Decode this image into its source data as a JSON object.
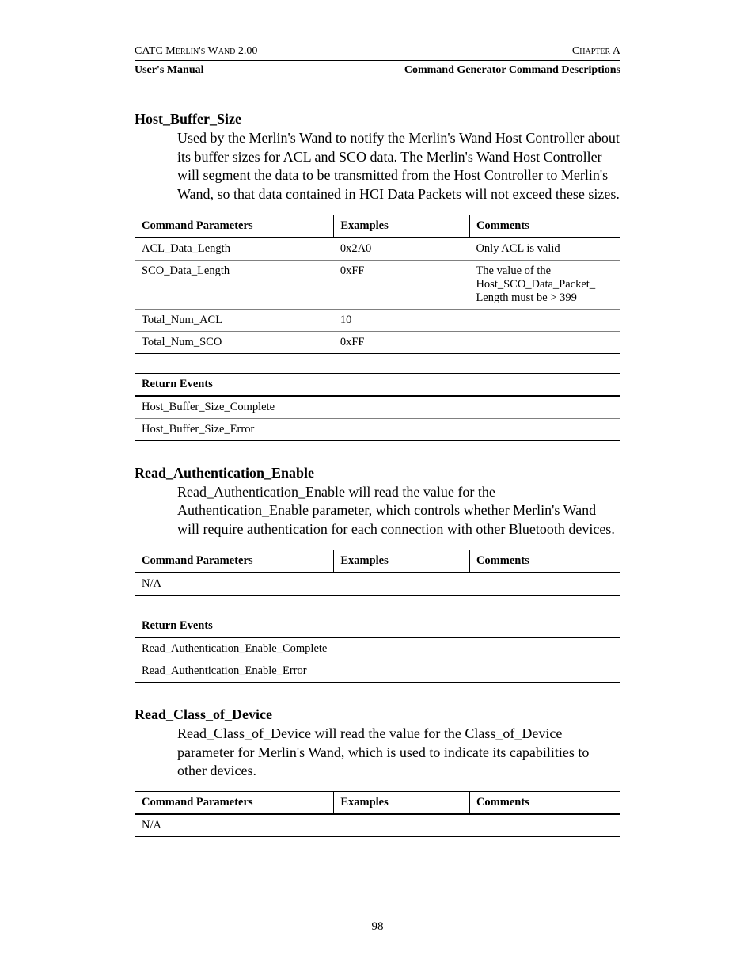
{
  "header": {
    "left_top": "CATC Merlin's Wand 2.00",
    "right_top": "Chapter A",
    "left_bot": "User's Manual",
    "right_bot": "Command Generator Command Descriptions"
  },
  "sections": [
    {
      "title": "Host_Buffer_Size",
      "body": "Used by the Merlin's Wand to notify the Merlin's Wand Host Controller about its buffer sizes for ACL and SCO data. The Merlin's Wand Host Controller will segment the data to be transmitted from the Host Controller to Merlin's Wand, so that data contained in HCI Data Packets will not exceed these sizes.",
      "param_headers": [
        "Command Parameters",
        "Examples",
        "Comments"
      ],
      "params": [
        {
          "p": "ACL_Data_Length",
          "e": "0x2A0",
          "c": "Only ACL is valid"
        },
        {
          "p": "SCO_Data_Length",
          "e": "0xFF",
          "c": "The value of the Host_SCO_Data_Packet_ Length must be > 399"
        },
        {
          "p": "Total_Num_ACL",
          "e": "10",
          "c": ""
        },
        {
          "p": "Total_Num_SCO",
          "e": "0xFF",
          "c": ""
        }
      ],
      "return_header": "Return Events",
      "returns": [
        "Host_Buffer_Size_Complete",
        "Host_Buffer_Size_Error"
      ]
    },
    {
      "title": "Read_Authentication_Enable",
      "body": "Read_Authentication_Enable will read the value for the Authentication_Enable parameter, which controls whether Merlin's Wand will require authentication for each connection with other Bluetooth devices.",
      "param_headers": [
        "Command Parameters",
        "Examples",
        "Comments"
      ],
      "params": [
        {
          "p": "N/A",
          "e": "",
          "c": ""
        }
      ],
      "return_header": "Return Events",
      "returns": [
        "Read_Authentication_Enable_Complete",
        "Read_Authentication_Enable_Error"
      ]
    },
    {
      "title": "Read_Class_of_Device",
      "body": "Read_Class_of_Device will read the value for the Class_of_Device parameter for Merlin's Wand, which is used to indicate its capabilities to other devices.",
      "param_headers": [
        "Command Parameters",
        "Examples",
        "Comments"
      ],
      "params": [
        {
          "p": "N/A",
          "e": "",
          "c": ""
        }
      ],
      "return_header": "",
      "returns": []
    }
  ],
  "page_number": "98"
}
